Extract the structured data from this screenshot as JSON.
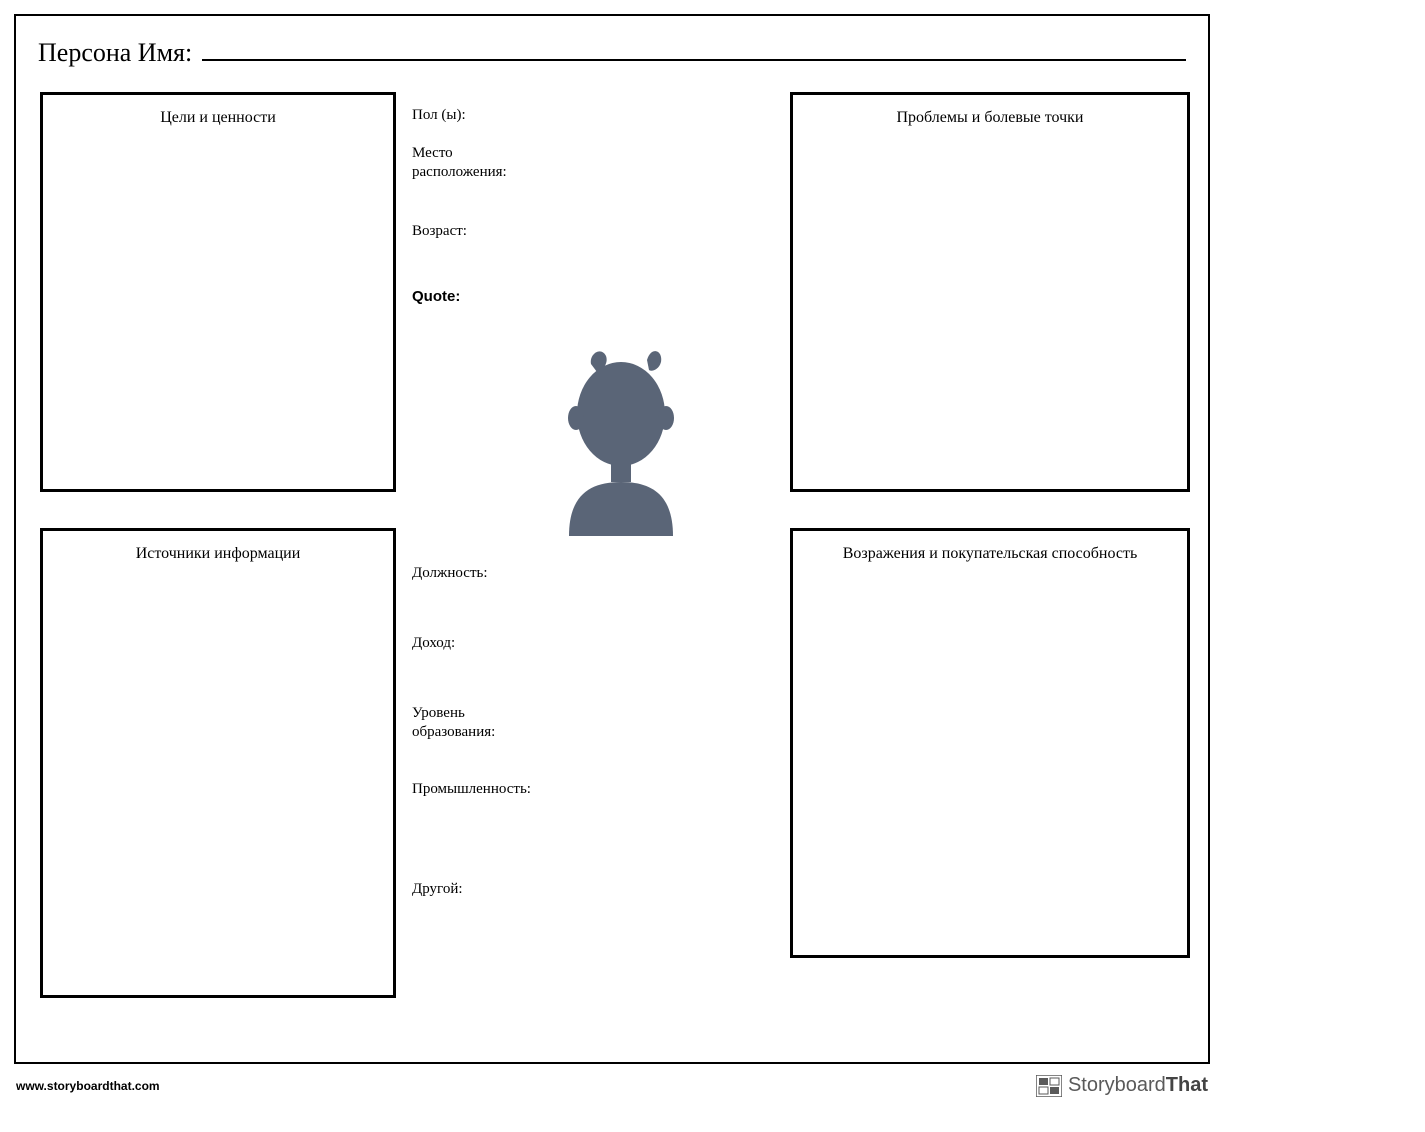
{
  "header": {
    "persona_name_label": "Персона Имя:"
  },
  "boxes": {
    "top_left_title": "Цели и ценности",
    "top_right_title": "Проблемы и болевые точки",
    "bottom_left_title": "Источники информации",
    "bottom_right_title": "Возражения и покупательская способность"
  },
  "fields_top": {
    "gender": "Пол (ы):",
    "location": "Место расположения:",
    "age": "Возраст:",
    "quote": "Quote:"
  },
  "fields_bottom": {
    "position": "Должность:",
    "income": "Доход:",
    "education": "Уровень образования:",
    "industry": "Промышленность:",
    "other": "Другой:"
  },
  "footer": {
    "url": "www.storyboardthat.com",
    "brand_light": "Storyboard",
    "brand_bold": "That"
  },
  "avatar": {
    "fill": "#5a6577"
  }
}
